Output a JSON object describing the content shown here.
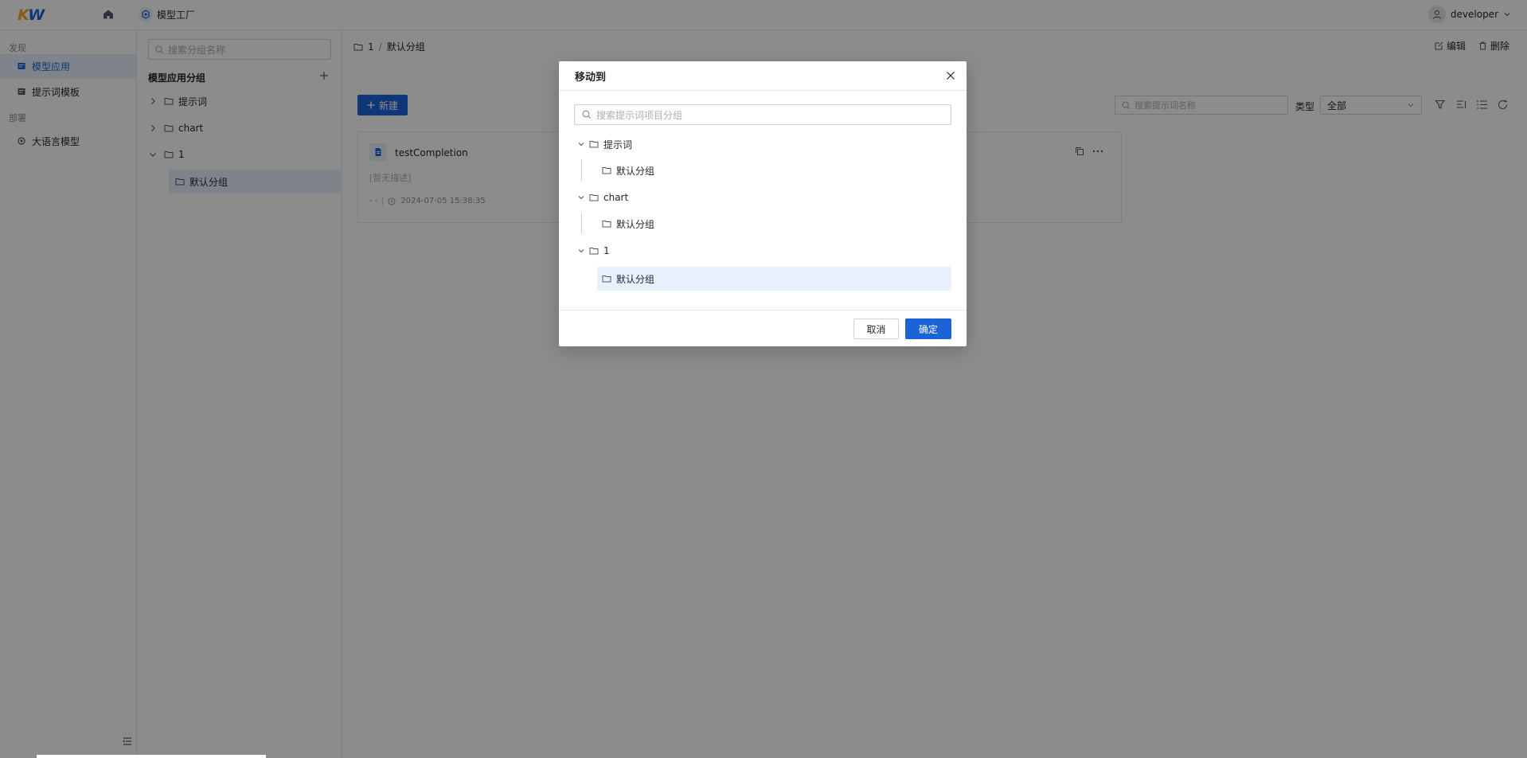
{
  "header": {
    "logo_k": "K",
    "logo_w": "W",
    "app_title": "模型工厂",
    "username": "developer"
  },
  "leftnav": {
    "section_discover": "发现",
    "items": [
      {
        "label": "模型应用",
        "icon": "app-grid-icon"
      },
      {
        "label": "提示词模板",
        "icon": "template-icon"
      }
    ],
    "section_deploy": "部署",
    "deploy_items": [
      {
        "label": "大语言模型",
        "icon": "model-icon"
      }
    ]
  },
  "groups": {
    "search_placeholder": "搜索分组名称",
    "title": "模型应用分组",
    "tree": [
      {
        "label": "提示词",
        "expanded": false
      },
      {
        "label": "chart",
        "expanded": false
      },
      {
        "label": "1",
        "expanded": true,
        "children": [
          {
            "label": "默认分组",
            "selected": true
          }
        ]
      }
    ]
  },
  "main": {
    "breadcrumb": [
      "1",
      "默认分组"
    ],
    "breadcrumb_sep": "/",
    "edit_label": "编辑",
    "delete_label": "删除",
    "new_button": "新建",
    "search_placeholder": "搜索提示词名称",
    "type_label": "类型",
    "type_value": "全部",
    "card": {
      "title": "testCompletion",
      "description": "[暂无描述]",
      "author": "- -",
      "timestamp": "2024-07-05 15:38:35"
    }
  },
  "modal": {
    "title": "移动到",
    "search_placeholder": "搜索提示词项目分组",
    "tree": [
      {
        "label": "提示词",
        "children": [
          {
            "label": "默认分组"
          }
        ]
      },
      {
        "label": "chart",
        "children": [
          {
            "label": "默认分组"
          }
        ]
      },
      {
        "label": "1",
        "children": [
          {
            "label": "默认分组",
            "selected": true
          }
        ]
      }
    ],
    "cancel_label": "取消",
    "ok_label": "确定"
  },
  "colors": {
    "primary": "#1d63d8",
    "selected_bg": "#e8f0fd",
    "overlay": "rgba(0,0,0,0.45)"
  }
}
